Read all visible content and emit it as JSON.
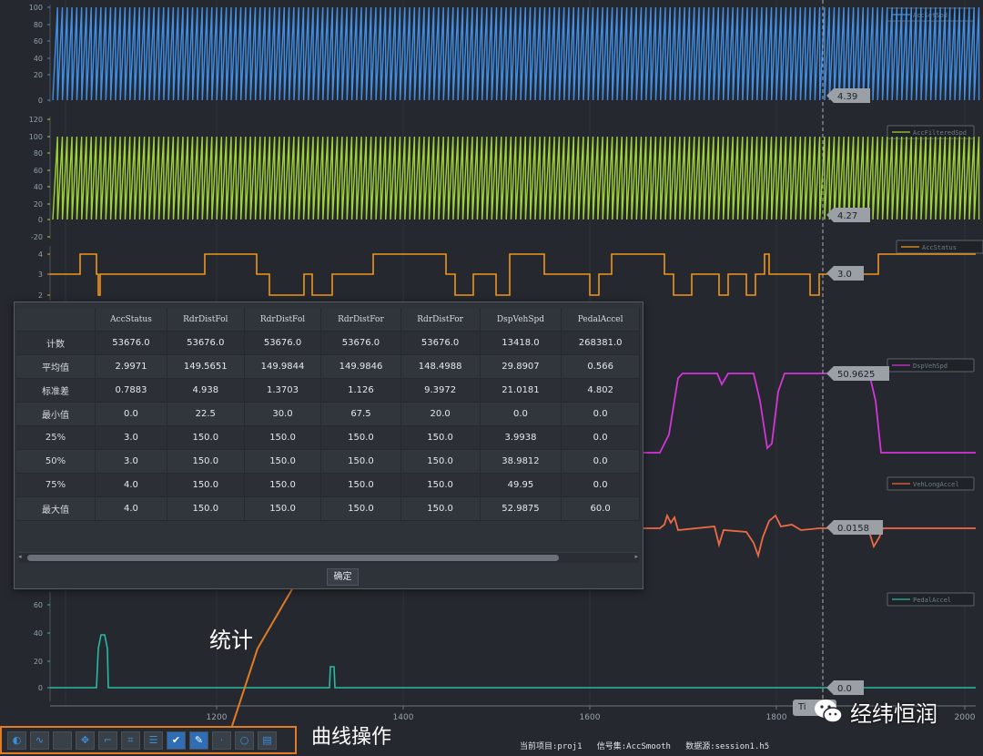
{
  "x_axis": {
    "ticks": [
      "1200",
      "1400",
      "1600",
      "1800",
      "2000"
    ]
  },
  "channels": [
    {
      "legend": "AccSetSpd",
      "color": "#3f8fe8",
      "y_ticks": [
        "100",
        "80",
        "60",
        "40",
        "20",
        "0"
      ],
      "cursor_value": "4.39"
    },
    {
      "legend": "AccFilteredSpd",
      "color": "#9fd333",
      "y_ticks": [
        "120",
        "100",
        "80",
        "60",
        "40",
        "20",
        "0",
        "-20"
      ],
      "cursor_value": "4.27"
    },
    {
      "legend": "AccStatus",
      "color": "#f0951f",
      "y_ticks": [
        "4",
        "3",
        "2"
      ],
      "cursor_value": "3.0"
    },
    {
      "legend": "DspVehSpd",
      "color": "#d535d8",
      "y_ticks": [],
      "cursor_value": "50.9625"
    },
    {
      "legend": "VehLongAccel",
      "color": "#ee6a45",
      "y_ticks": [],
      "cursor_value": "0.0158"
    },
    {
      "legend": "PedalAccel",
      "color": "#2ab9a4",
      "y_ticks": [
        "60",
        "40",
        "20",
        "0"
      ],
      "cursor_value": "0.0"
    }
  ],
  "stats_dialog": {
    "columns": [
      "AccStatus",
      "RdrDistFol",
      "RdrDistFol",
      "RdrDistFor",
      "RdrDistFor",
      "DspVehSpd",
      "PedalAccel"
    ],
    "rows": [
      {
        "label": "计数",
        "values": [
          "53676.0",
          "53676.0",
          "53676.0",
          "53676.0",
          "53676.0",
          "13418.0",
          "268381.0"
        ]
      },
      {
        "label": "平均值",
        "values": [
          "2.9971",
          "149.5651",
          "149.9844",
          "149.9846",
          "148.4988",
          "29.8907",
          "0.566"
        ]
      },
      {
        "label": "标准差",
        "values": [
          "0.7883",
          "4.938",
          "1.3703",
          "1.126",
          "9.3972",
          "21.0181",
          "4.802"
        ]
      },
      {
        "label": "最小值",
        "values": [
          "0.0",
          "22.5",
          "30.0",
          "67.5",
          "20.0",
          "0.0",
          "0.0"
        ]
      },
      {
        "label": "25%",
        "values": [
          "3.0",
          "150.0",
          "150.0",
          "150.0",
          "150.0",
          "3.9938",
          "0.0"
        ]
      },
      {
        "label": "50%",
        "values": [
          "3.0",
          "150.0",
          "150.0",
          "150.0",
          "150.0",
          "38.9812",
          "0.0"
        ]
      },
      {
        "label": "75%",
        "values": [
          "4.0",
          "150.0",
          "150.0",
          "150.0",
          "150.0",
          "49.95",
          "0.0"
        ]
      },
      {
        "label": "最大值",
        "values": [
          "4.0",
          "150.0",
          "150.0",
          "150.0",
          "150.0",
          "52.9875",
          "60.0"
        ]
      }
    ],
    "confirm_label": "确定",
    "scroll_left": "◂",
    "scroll_right": "▸"
  },
  "annotations": {
    "stats": "统计",
    "curve_ops": "曲线操作"
  },
  "status_bar": "当前项目:proj1   信号集:AccSmooth   数据源:session1.h5",
  "time_badge": "Ti",
  "watermark": "经纬恒润",
  "colors": {
    "background": "#25282e",
    "annotation_line": "#e07b26",
    "toolbar_active": "#2f6db5"
  },
  "toolbar": {
    "buttons": [
      {
        "name": "palette-icon",
        "glyph": "◐"
      },
      {
        "name": "wave-icon",
        "glyph": "∿"
      },
      {
        "name": "blank-icon",
        "glyph": " "
      },
      {
        "name": "move-icon",
        "glyph": "✥"
      },
      {
        "name": "crop-icon",
        "glyph": "⌐"
      },
      {
        "name": "frame-icon",
        "glyph": "⌗"
      },
      {
        "name": "list-icon",
        "glyph": "☰"
      },
      {
        "name": "check-icon",
        "glyph": "✔"
      },
      {
        "name": "pen-icon",
        "glyph": "✎"
      },
      {
        "name": "dot-icon",
        "glyph": "·"
      },
      {
        "name": "circle-icon",
        "glyph": "○"
      },
      {
        "name": "save-icon",
        "glyph": "▤"
      }
    ],
    "active": [
      7,
      8
    ]
  }
}
